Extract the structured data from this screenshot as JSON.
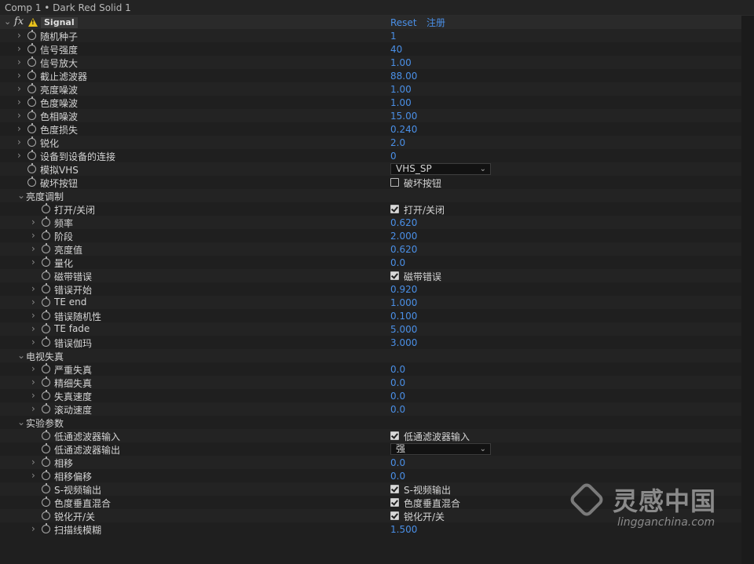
{
  "window": {
    "title": "Comp 1 • Dark Red Solid 1"
  },
  "effect": {
    "name": "Signal",
    "reset_label": "Reset",
    "register_label": "注册"
  },
  "rows": [
    {
      "type": "value",
      "label": "随机种子",
      "value": "1",
      "indent": 1,
      "twirl": true,
      "stopwatch": true
    },
    {
      "type": "value",
      "label": "信号强度",
      "value": "40",
      "indent": 1,
      "twirl": true,
      "stopwatch": true
    },
    {
      "type": "value",
      "label": "信号放大",
      "value": "1.00",
      "indent": 1,
      "twirl": true,
      "stopwatch": true
    },
    {
      "type": "value",
      "label": "截止滤波器",
      "value": "88.00",
      "indent": 1,
      "twirl": true,
      "stopwatch": true
    },
    {
      "type": "value",
      "label": "亮度噪波",
      "value": "1.00",
      "indent": 1,
      "twirl": true,
      "stopwatch": true
    },
    {
      "type": "value",
      "label": "色度噪波",
      "value": "1.00",
      "indent": 1,
      "twirl": true,
      "stopwatch": true
    },
    {
      "type": "value",
      "label": "色相噪波",
      "value": "15.00",
      "indent": 1,
      "twirl": true,
      "stopwatch": true
    },
    {
      "type": "value",
      "label": "色度损失",
      "value": "0.240",
      "indent": 1,
      "twirl": true,
      "stopwatch": true
    },
    {
      "type": "value",
      "label": "锐化",
      "value": "2.0",
      "indent": 1,
      "twirl": true,
      "stopwatch": true
    },
    {
      "type": "value",
      "label": "设备到设备的连接",
      "value": "0",
      "indent": 1,
      "twirl": true,
      "stopwatch": true
    },
    {
      "type": "dropdown",
      "label": "模拟VHS",
      "value": "VHS_SP",
      "indent": 1,
      "twirl": false,
      "stopwatch": true
    },
    {
      "type": "checkbox",
      "label": "破坏按钮",
      "value": "破坏按钮",
      "checked": false,
      "indent": 1,
      "twirl": false,
      "stopwatch": true
    },
    {
      "type": "group",
      "label": "亮度调制",
      "indent": 0
    },
    {
      "type": "checkbox",
      "label": "打开/关闭",
      "value": "打开/关闭",
      "checked": true,
      "indent": 2,
      "twirl": false,
      "stopwatch": true
    },
    {
      "type": "value",
      "label": "频率",
      "value": "0.620",
      "indent": 2,
      "twirl": true,
      "stopwatch": true
    },
    {
      "type": "value",
      "label": "阶段",
      "value": "2.000",
      "indent": 2,
      "twirl": true,
      "stopwatch": true
    },
    {
      "type": "value",
      "label": "亮度值",
      "value": "0.620",
      "indent": 2,
      "twirl": true,
      "stopwatch": true
    },
    {
      "type": "value",
      "label": "量化",
      "value": "0.0",
      "indent": 2,
      "twirl": true,
      "stopwatch": true
    },
    {
      "type": "checkbox",
      "label": "磁带错误",
      "value": "磁带错误",
      "checked": true,
      "indent": 2,
      "twirl": false,
      "stopwatch": true
    },
    {
      "type": "value",
      "label": "错误开始",
      "value": "0.920",
      "indent": 2,
      "twirl": true,
      "stopwatch": true
    },
    {
      "type": "value",
      "label": "TE end",
      "value": "1.000",
      "indent": 2,
      "twirl": true,
      "stopwatch": true
    },
    {
      "type": "value",
      "label": "错误随机性",
      "value": "0.100",
      "indent": 2,
      "twirl": true,
      "stopwatch": true
    },
    {
      "type": "value",
      "label": "TE fade",
      "value": "5.000",
      "indent": 2,
      "twirl": true,
      "stopwatch": true
    },
    {
      "type": "value",
      "label": "错误伽玛",
      "value": "3.000",
      "indent": 2,
      "twirl": true,
      "stopwatch": true
    },
    {
      "type": "group",
      "label": "电视失真",
      "indent": 0
    },
    {
      "type": "value",
      "label": "严重失真",
      "value": "0.0",
      "indent": 2,
      "twirl": true,
      "stopwatch": true
    },
    {
      "type": "value",
      "label": "精细失真",
      "value": "0.0",
      "indent": 2,
      "twirl": true,
      "stopwatch": true
    },
    {
      "type": "value",
      "label": "失真速度",
      "value": "0.0",
      "indent": 2,
      "twirl": true,
      "stopwatch": true
    },
    {
      "type": "value",
      "label": "滚动速度",
      "value": "0.0",
      "indent": 2,
      "twirl": true,
      "stopwatch": true
    },
    {
      "type": "group",
      "label": "实验参数",
      "indent": 0
    },
    {
      "type": "checkbox",
      "label": "低通滤波器输入",
      "value": "低通滤波器输入",
      "checked": true,
      "indent": 2,
      "twirl": false,
      "stopwatch": true
    },
    {
      "type": "dropdown",
      "label": "低通滤波器输出",
      "value": "强",
      "indent": 2,
      "twirl": false,
      "stopwatch": true
    },
    {
      "type": "value",
      "label": "相移",
      "value": "0.0",
      "indent": 2,
      "twirl": true,
      "stopwatch": true
    },
    {
      "type": "value",
      "label": "相移偏移",
      "value": "0.0",
      "indent": 2,
      "twirl": true,
      "stopwatch": true
    },
    {
      "type": "checkbox",
      "label": "S-视频输出",
      "value": "S-视频输出",
      "checked": true,
      "indent": 2,
      "twirl": false,
      "stopwatch": true
    },
    {
      "type": "checkbox",
      "label": "色度垂直混合",
      "value": "色度垂直混合",
      "checked": true,
      "indent": 2,
      "twirl": false,
      "stopwatch": true
    },
    {
      "type": "checkbox",
      "label": "锐化开/关",
      "value": "锐化开/关",
      "checked": true,
      "indent": 2,
      "twirl": false,
      "stopwatch": true
    },
    {
      "type": "value",
      "label": "扫描线模糊",
      "value": "1.500",
      "indent": 2,
      "twirl": true,
      "stopwatch": true
    }
  ],
  "watermark": {
    "cn": "灵感中国",
    "en": "lingganchina.com"
  },
  "colors": {
    "value_blue": "#4a8fe6",
    "background": "#1f1f1f"
  }
}
